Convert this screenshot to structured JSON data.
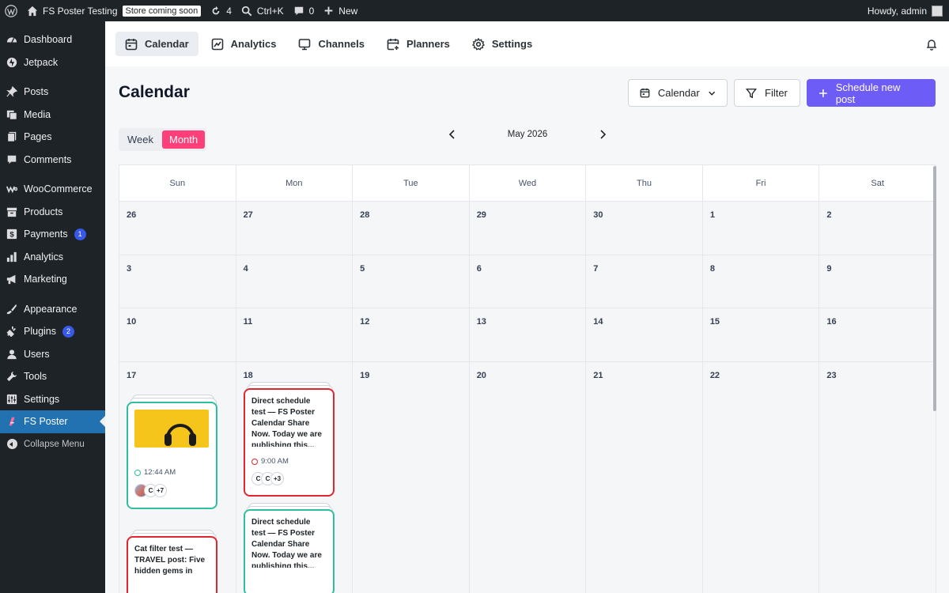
{
  "adminbar": {
    "site_name": "FS Poster Testing",
    "store_badge": "Store coming soon",
    "updates_count": "4",
    "search_shortcut": "Ctrl+K",
    "comments_count": "0",
    "new_label": "New",
    "howdy": "Howdy, admin"
  },
  "sidebar": {
    "items": [
      {
        "label": "Dashboard",
        "icon": "dashboard-icon"
      },
      {
        "label": "Jetpack",
        "icon": "jetpack-icon"
      },
      {
        "label": "Posts",
        "icon": "pin-icon"
      },
      {
        "label": "Media",
        "icon": "media-icon"
      },
      {
        "label": "Pages",
        "icon": "pages-icon"
      },
      {
        "label": "Comments",
        "icon": "comment-icon"
      },
      {
        "label": "WooCommerce",
        "icon": "woocommerce-icon"
      },
      {
        "label": "Products",
        "icon": "archive-icon"
      },
      {
        "label": "Payments",
        "icon": "payments-icon",
        "badge": "1"
      },
      {
        "label": "Analytics",
        "icon": "bar-chart-icon"
      },
      {
        "label": "Marketing",
        "icon": "megaphone-icon"
      },
      {
        "label": "Appearance",
        "icon": "brush-icon"
      },
      {
        "label": "Plugins",
        "icon": "plug-icon",
        "badge": "2"
      },
      {
        "label": "Users",
        "icon": "user-icon"
      },
      {
        "label": "Tools",
        "icon": "wrench-icon"
      },
      {
        "label": "Settings",
        "icon": "sliders-icon"
      },
      {
        "label": "FS Poster",
        "icon": "fs-poster-icon"
      },
      {
        "label": "Collapse Menu",
        "icon": "collapse-icon"
      }
    ]
  },
  "topnav": {
    "tabs": [
      {
        "label": "Calendar",
        "icon": "calendar-icon"
      },
      {
        "label": "Analytics",
        "icon": "analytics-icon"
      },
      {
        "label": "Channels",
        "icon": "monitor-icon"
      },
      {
        "label": "Planners",
        "icon": "calendar-plus-icon"
      },
      {
        "label": "Settings",
        "icon": "gear-icon"
      }
    ]
  },
  "page": {
    "title": "Calendar",
    "view_select": "Calendar",
    "filter_label": "Filter",
    "schedule_label": "Schedule new post",
    "toggle": {
      "week": "Week",
      "month": "Month"
    },
    "month_label": "May 2026"
  },
  "calendar": {
    "weekdays": [
      "Sun",
      "Mon",
      "Tue",
      "Wed",
      "Thu",
      "Fri",
      "Sat"
    ],
    "weeks": [
      [
        "26",
        "27",
        "28",
        "29",
        "30",
        "1",
        "2"
      ],
      [
        "3",
        "4",
        "5",
        "6",
        "7",
        "8",
        "9"
      ],
      [
        "10",
        "11",
        "12",
        "13",
        "14",
        "15",
        "16"
      ],
      [
        "17",
        "18",
        "19",
        "20",
        "21",
        "22",
        "23"
      ]
    ]
  },
  "posts": {
    "sun_card1": {
      "time": "12:44 AM",
      "avatars": [
        "C"
      ],
      "more": "+7"
    },
    "sun_card2": {
      "text": "Cat filter test — TRAVEL post: Five hidden gems in"
    },
    "mon_card1": {
      "text": "Direct schedule test — FS Poster Calendar Share Now. Today we are publishing this...",
      "time": "9:00 AM",
      "avatars": [
        "C",
        "C"
      ],
      "more": "+3"
    },
    "mon_card2": {
      "text": "Direct schedule test — FS Poster Calendar Share Now. Today we are publishing this..."
    }
  },
  "colors": {
    "accent_primary": "#6e5cf6",
    "month_toggle": "#ff3f7a",
    "card_teal": "#2fbfa0",
    "card_red": "#e0262e",
    "sidebar_active": "#2271b1"
  }
}
